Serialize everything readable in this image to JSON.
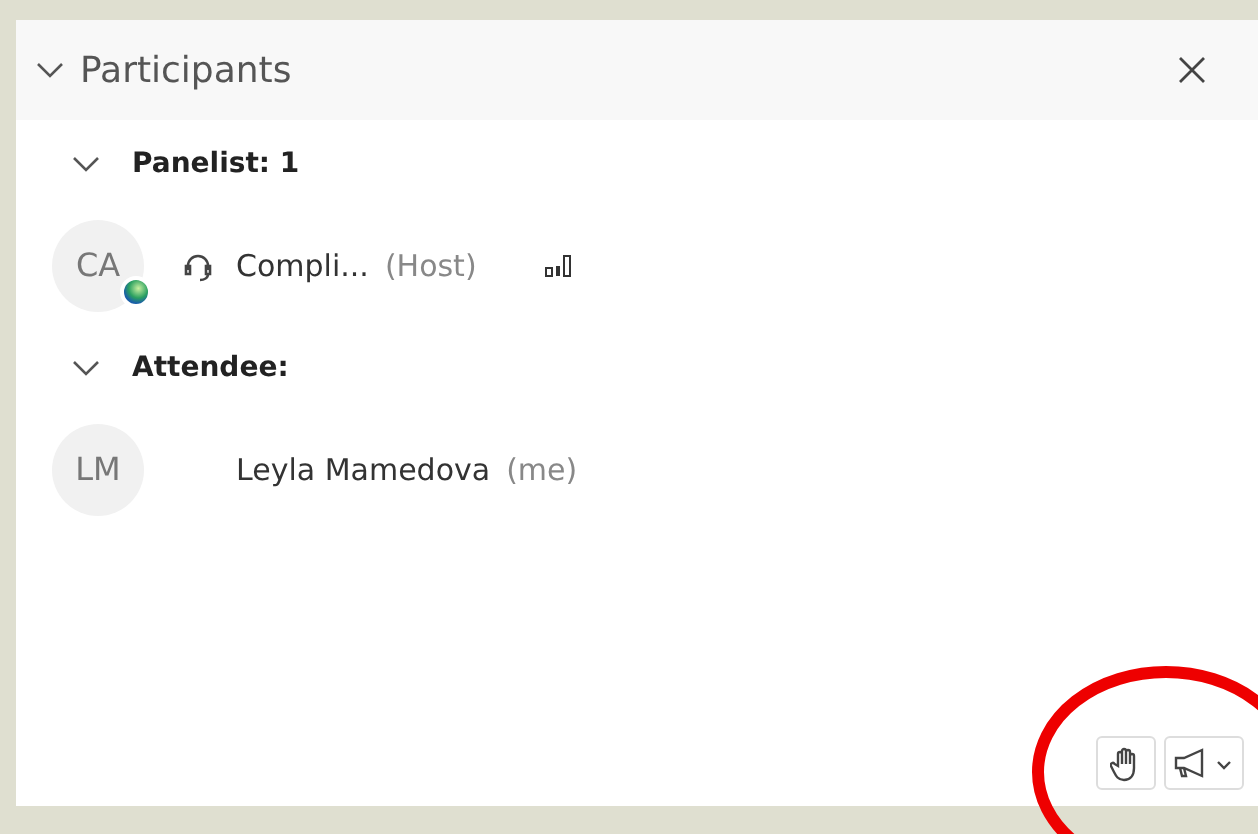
{
  "panel": {
    "title": "Participants",
    "expanded": true
  },
  "groups": [
    {
      "label": "Panelist: 1",
      "expanded": true,
      "participants": [
        {
          "initials": "CA",
          "name": "Compli...",
          "role": "(Host)",
          "kind": "host"
        }
      ]
    },
    {
      "label": "Attendee:",
      "expanded": true,
      "participants": [
        {
          "initials": "LM",
          "name": "Leyla Mamedova",
          "role": "(me)",
          "kind": "attendee"
        }
      ]
    }
  ],
  "annotation": {
    "kind": "circle",
    "color": "#ee0000"
  }
}
